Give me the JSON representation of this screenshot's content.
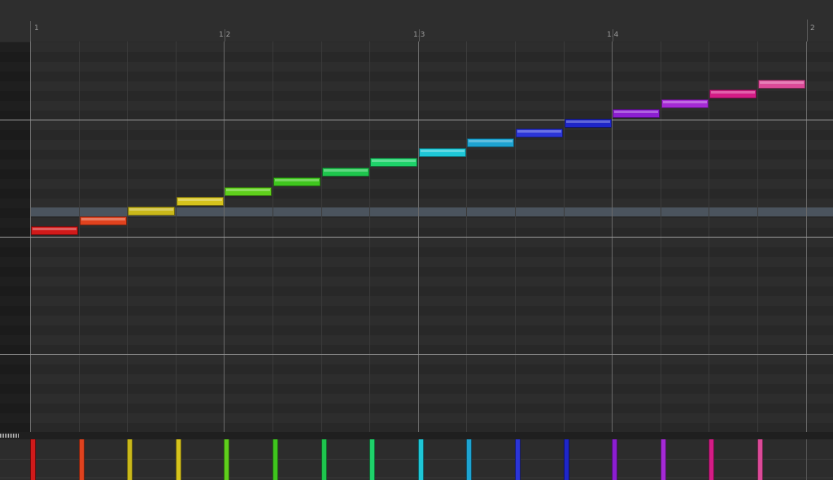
{
  "timeline": {
    "bar_labels": [
      "1",
      "1.2",
      "1.3",
      "1.4",
      "2"
    ]
  },
  "highlighted_row": {
    "color": "#4b545e"
  },
  "notes": [
    {
      "index": 1,
      "color": "#d11a1a"
    },
    {
      "index": 2,
      "color": "#e0421e"
    },
    {
      "index": 3,
      "color": "#c9b81a"
    },
    {
      "index": 4,
      "color": "#d6c31c"
    },
    {
      "index": 5,
      "color": "#5fcf1c"
    },
    {
      "index": 6,
      "color": "#3fc61e"
    },
    {
      "index": 7,
      "color": "#1ec64d"
    },
    {
      "index": 8,
      "color": "#1ed26a"
    },
    {
      "index": 9,
      "color": "#1ec6d6"
    },
    {
      "index": 10,
      "color": "#1ea3d1"
    },
    {
      "index": 11,
      "color": "#2b35d8"
    },
    {
      "index": 12,
      "color": "#1e26c9"
    },
    {
      "index": 13,
      "color": "#8c1ed1"
    },
    {
      "index": 14,
      "color": "#a52ad6"
    },
    {
      "index": 15,
      "color": "#d41c86"
    },
    {
      "index": 16,
      "color": "#dc4a98"
    }
  ],
  "velocity_pane": {
    "handle_icon": "resize-grip-icon"
  }
}
